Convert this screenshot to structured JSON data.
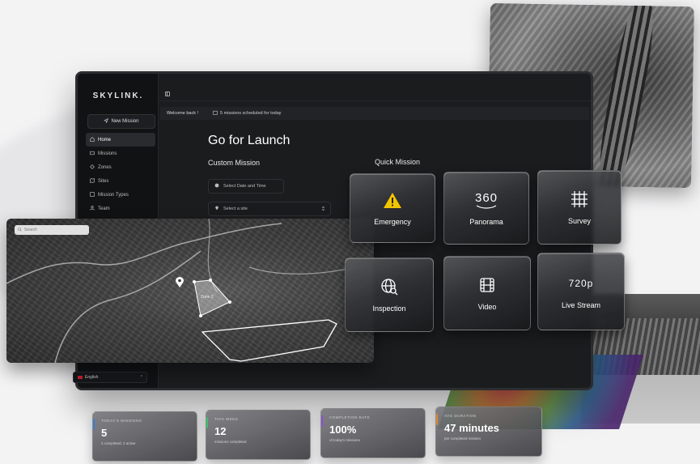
{
  "app": {
    "logo": "SKYLINK."
  },
  "sidebar": {
    "new_mission_label": "New Mission",
    "items": [
      {
        "label": "Home",
        "icon": "home-icon",
        "active": true
      },
      {
        "label": "Missions",
        "icon": "missions-icon",
        "active": false
      },
      {
        "label": "Zones",
        "icon": "zones-icon",
        "active": false
      },
      {
        "label": "Sites",
        "icon": "sites-icon",
        "active": false
      },
      {
        "label": "Mission Types",
        "icon": "mission-types-icon",
        "active": false
      },
      {
        "label": "Team",
        "icon": "team-icon",
        "active": false
      }
    ],
    "language": "English"
  },
  "header": {
    "welcome": "Welcome back !",
    "schedule_text": "5 missions scheduled for today"
  },
  "main": {
    "title": "Go for Launch",
    "custom_mission_title": "Custom Mission",
    "date_placeholder": "Select Date and Time",
    "site_placeholder": "Select a site",
    "quick_mission_title": "Quick Mission"
  },
  "map": {
    "search_placeholder": "Search",
    "zone_label": "Zone 2"
  },
  "quick_missions": [
    {
      "label": "Emergency",
      "icon": "warning-icon",
      "icon_text": ""
    },
    {
      "label": "Panorama",
      "icon": "panorama-360-icon",
      "icon_text": "360"
    },
    {
      "label": "Survey",
      "icon": "grid-survey-icon",
      "icon_text": ""
    },
    {
      "label": "Inspection",
      "icon": "globe-search-icon",
      "icon_text": ""
    },
    {
      "label": "Video",
      "icon": "film-icon",
      "icon_text": ""
    },
    {
      "label": "Live Stream",
      "icon": "live-stream-icon",
      "icon_text": "720p"
    }
  ],
  "stats": [
    {
      "label": "TODAY'S MISSIONS",
      "value": "5",
      "sub": "2 completed, 2 active",
      "accent": "#3a7bd5"
    },
    {
      "label": "THIS WEEK",
      "value": "12",
      "sub": "missions completed",
      "accent": "#3fbf6a"
    },
    {
      "label": "COMPLETION RATE",
      "value": "100%",
      "sub": "of today's missions",
      "accent": "#8a4fd8"
    },
    {
      "label": "AVG DURATION",
      "value": "47 minutes",
      "sub": "per completed mission",
      "accent": "#e08a2b"
    }
  ],
  "colors": {
    "warning": "#f2c500",
    "screen_bg": "#1b1c1e",
    "sidebar_bg": "#111214"
  }
}
